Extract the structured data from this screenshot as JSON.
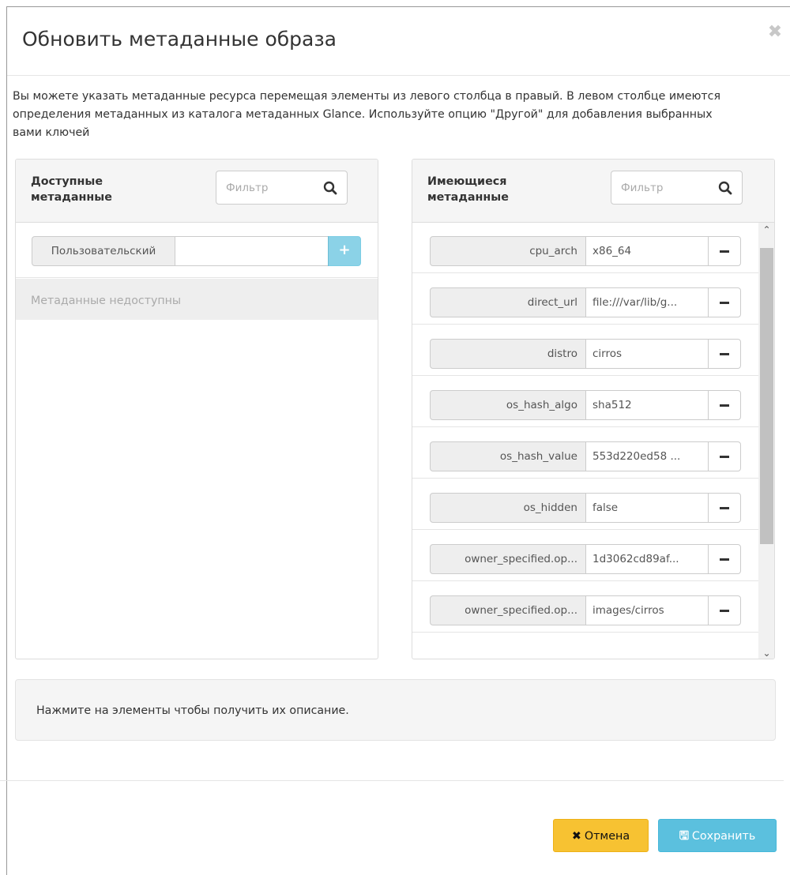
{
  "modal": {
    "title": "Обновить метаданные образа",
    "close_icon": "close-icon",
    "description": "Вы можете указать метаданные ресурса перемещая элементы из левого столбца в правый. В левом столбце имеются определения метаданных из каталога метаданных Glance. Используйте опцию \"Другой\" для добавления выбранных вами ключей"
  },
  "available": {
    "title": "Доступные метаданные",
    "filter_placeholder": "Фильтр",
    "custom_label": "Пользовательский",
    "custom_value": "",
    "add_icon": "plus-icon",
    "empty_text": "Метаданные недоступны"
  },
  "existing": {
    "title": "Имеющиеся метаданные",
    "filter_placeholder": "Фильтр",
    "items": [
      {
        "key": "cpu_arch",
        "value": "x86_64"
      },
      {
        "key": "direct_url",
        "value": "file:///var/lib/g..."
      },
      {
        "key": "distro",
        "value": "cirros"
      },
      {
        "key": "os_hash_algo",
        "value": "sha512"
      },
      {
        "key": "os_hash_value",
        "value": "553d220ed58 ..."
      },
      {
        "key": "os_hidden",
        "value": "false"
      },
      {
        "key": "owner_specified.op...",
        "value": "1d3062cd89af..."
      },
      {
        "key": "owner_specified.op...",
        "value": "images/cirros"
      }
    ]
  },
  "info": {
    "text": "Нажмите на элементы чтобы получить их описание."
  },
  "footer": {
    "cancel_label": "Отмена",
    "save_label": "Сохранить",
    "cancel_icon": "x-icon",
    "save_icon": "floppy-disk-icon"
  }
}
